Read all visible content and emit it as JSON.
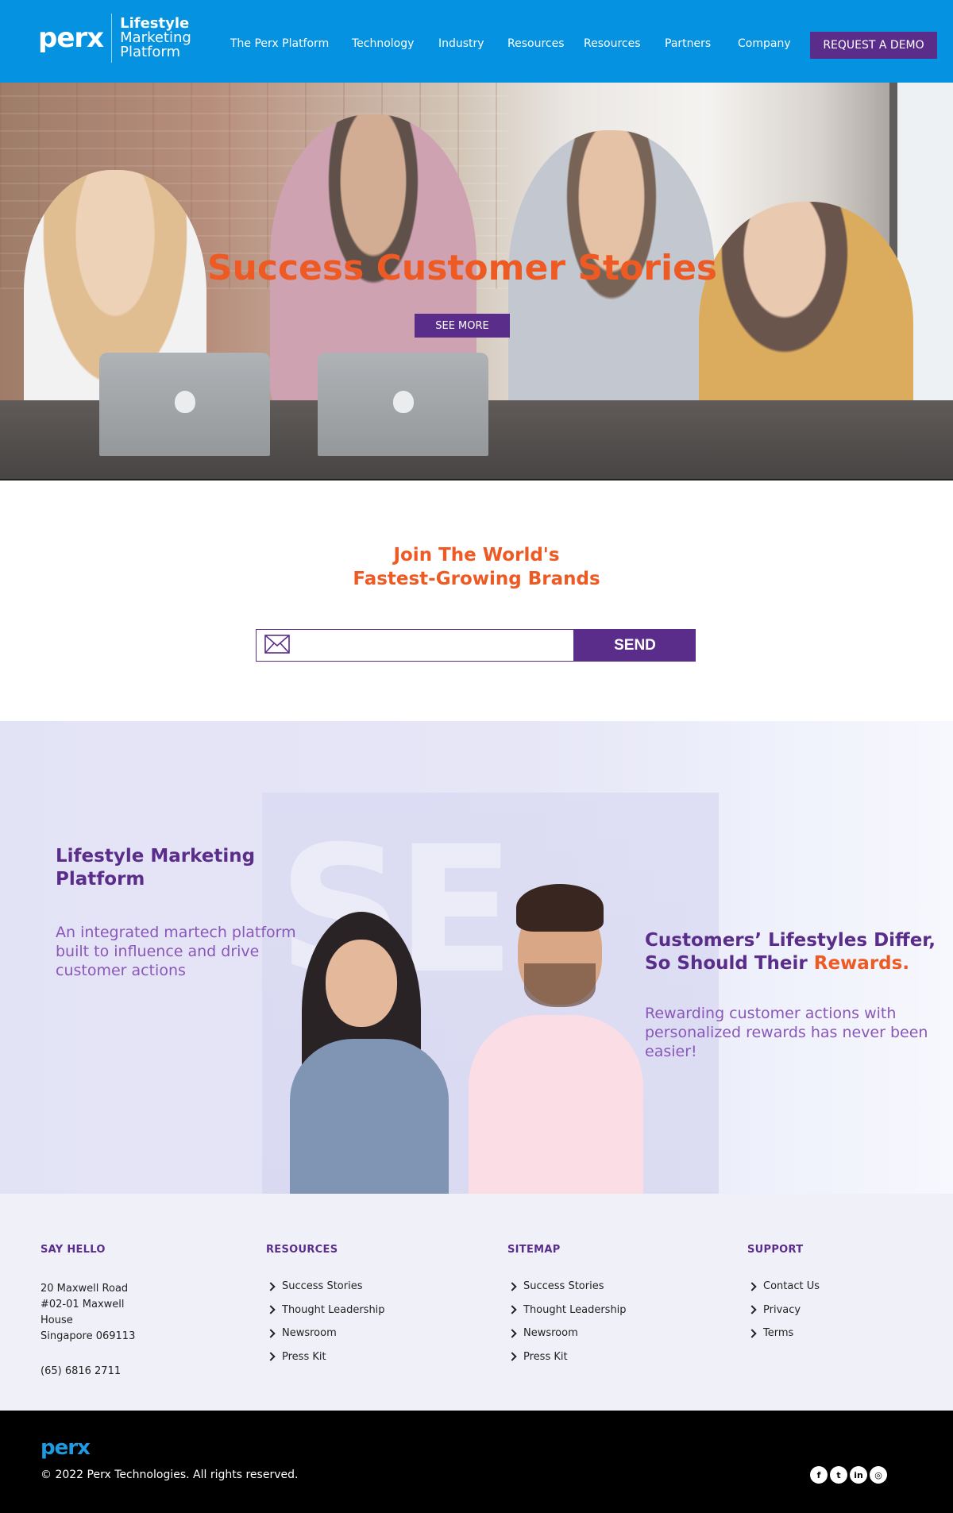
{
  "header": {
    "logo_text": "perx",
    "tagline_line1": "Lifestyle",
    "tagline_line2": "Marketing",
    "tagline_line3": "Platform",
    "nav": [
      "The Perx Platform",
      "Technology",
      "Industry",
      "Resources",
      "Resources",
      "Partners",
      "Company"
    ],
    "demo_button": "REQUEST A DEMO"
  },
  "hero": {
    "title": "Success Customer Stories",
    "button": "SEE MORE"
  },
  "join": {
    "title_line1": "Join The World's",
    "title_line2": "Fastest-Growing Brands",
    "email_value": "",
    "send_button": "SEND"
  },
  "platform": {
    "background_text": "SE",
    "title": "Lifestyle Marketing Platform",
    "description": "An integrated martech platform built to influence and drive customer actions",
    "right_title_part1": "Customers’ Lifestyles Differ, So Should Their ",
    "right_title_accent": "Rewards.",
    "right_description": "Rewarding customer actions with personalized rewards has never been easier!"
  },
  "footer": {
    "say_hello": {
      "heading": "SAY HELLO",
      "address_line1": "20 Maxwell Road",
      "address_line2": "#02-01 Maxwell",
      "address_line3": "House",
      "address_line4": "Singapore 069113",
      "phone": "(65) 6816 2711"
    },
    "resources": {
      "heading": "RESOURCES",
      "items": [
        "Success Stories",
        "Thought Leadership",
        "Newsroom",
        "Press Kit"
      ]
    },
    "sitemap": {
      "heading": "SITEMAP",
      "items": [
        "Success Stories",
        "Thought Leadership",
        "Newsroom",
        "Press Kit"
      ]
    },
    "support": {
      "heading": "SUPPORT",
      "items": [
        "Contact Us",
        "Privacy",
        "Terms"
      ]
    }
  },
  "bottom": {
    "logo_text": "perx",
    "copyright": "© 2022 Perx Technologies. All rights reserved.",
    "socials": [
      {
        "icon": "facebook-icon",
        "glyph": "f"
      },
      {
        "icon": "twitter-icon",
        "glyph": "t"
      },
      {
        "icon": "linkedin-icon",
        "glyph": "in"
      },
      {
        "icon": "instagram-icon",
        "glyph": "◎"
      }
    ]
  },
  "colors": {
    "header_blue": "#0592e0",
    "brand_purple": "#5a2d8a",
    "accent_orange": "#ee5a24",
    "light_purple_text": "#8a57b8"
  }
}
